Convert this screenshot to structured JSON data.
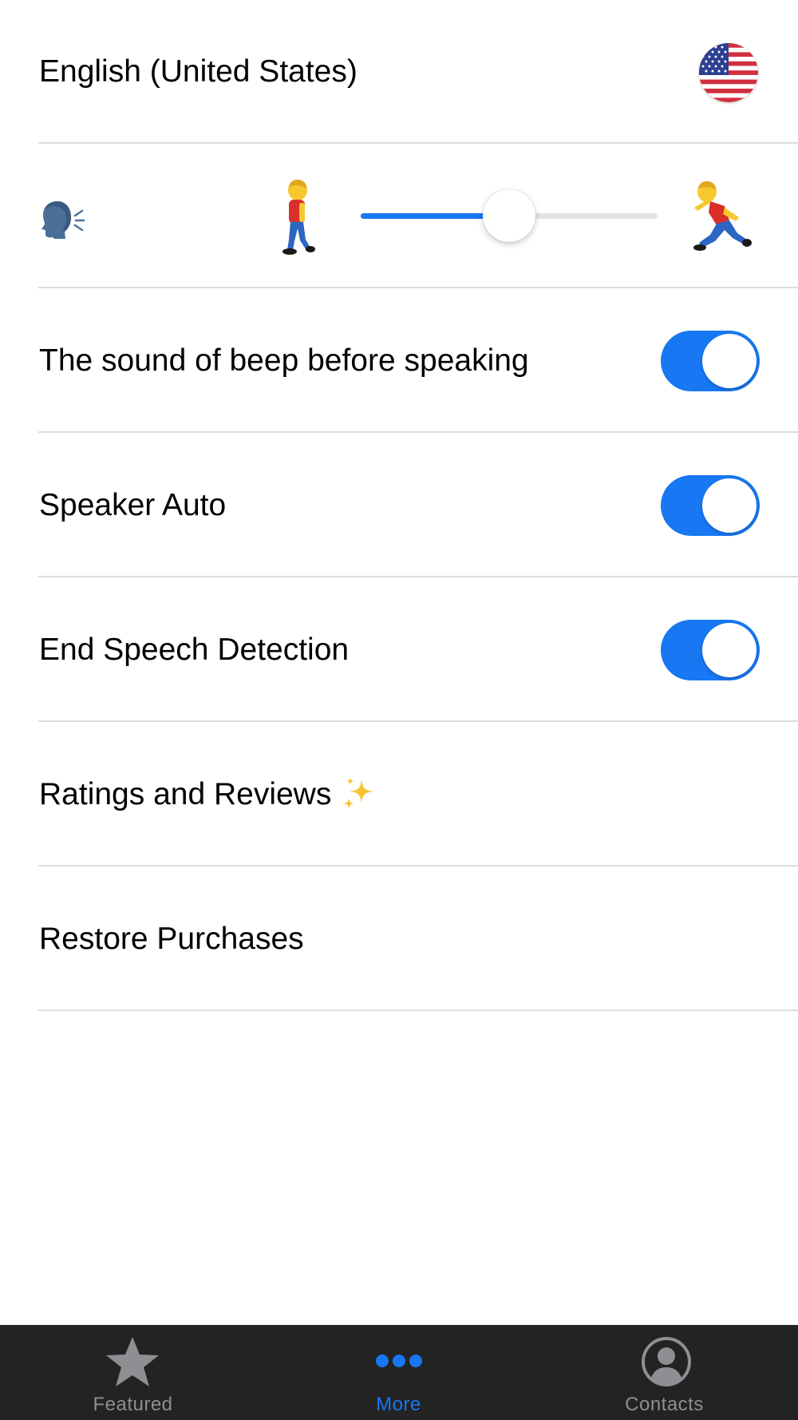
{
  "settings": {
    "language": {
      "label": "English (United States)",
      "icon": "us-flag-icon"
    },
    "speech_rate": {
      "icon_left": "speaking-head-icon",
      "icon_slow": "walking-person-icon",
      "icon_fast": "running-person-icon",
      "value": 0.5
    },
    "beep": {
      "label": "The sound of beep before speaking",
      "on": true
    },
    "speaker_auto": {
      "label": "Speaker Auto",
      "on": true
    },
    "end_speech": {
      "label": "End Speech Detection",
      "on": true
    },
    "ratings": {
      "label": "Ratings and Reviews",
      "icon": "sparkles-icon"
    },
    "restore": {
      "label": "Restore Purchases"
    }
  },
  "tabbar": {
    "tabs": [
      {
        "label": "Featured",
        "icon": "star-icon",
        "active": false
      },
      {
        "label": "More",
        "icon": "more-dots-icon",
        "active": true
      },
      {
        "label": "Contacts",
        "icon": "person-circle-icon",
        "active": false
      }
    ]
  },
  "colors": {
    "accent": "#1877f2",
    "tabbar_bg": "#232323",
    "inactive_tab": "#8e8e93",
    "divider": "#dcdcdf"
  }
}
